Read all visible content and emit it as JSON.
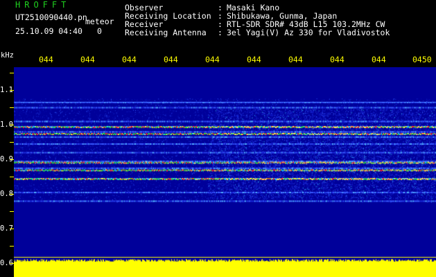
{
  "header": {
    "brand": "HROFFT",
    "filename": "UT2510090440.pn",
    "mode": "meteor",
    "datetime": "25.10.09 04:40",
    "counter": "0",
    "fields": [
      {
        "label": "Observer",
        "value": "Masaki Kano"
      },
      {
        "label": "Receiving Location",
        "value": "Shibukawa, Gunma, Japan"
      },
      {
        "label": "Receiver",
        "value": "RTL-SDR SDR# 43dB L15 103.2MHz CW"
      },
      {
        "label": "Receiving Antenna",
        "value": "3el Yagi(V) Az 330 for Vladivostok"
      }
    ],
    "separator": ":"
  },
  "time_ticks": [
    "044",
    "044",
    "044",
    "044",
    "044",
    "044",
    "044",
    "044",
    "044",
    "0450"
  ],
  "y_axis": {
    "unit": "kHz",
    "labels": [
      "1.1",
      "1.0",
      "0.9",
      "0.8",
      "0.7",
      "0.6"
    ]
  },
  "colors": {
    "background": "#000000",
    "plot_background": "#00009a",
    "ticks": "#ffff00",
    "brand": "#1fd21f",
    "text": "#ffffff",
    "power_trace": "#ffff00"
  },
  "spectrogram": {
    "frequency_range_khz": [
      0.6,
      1.15
    ],
    "carrier_lines_khz": [
      1.05,
      1.035,
      0.995,
      0.98,
      0.965,
      0.95,
      0.93,
      0.905,
      0.88,
      0.86,
      0.83,
      0.79,
      0.765
    ],
    "strong_lines_khz": [
      0.98,
      0.96,
      0.877,
      0.855,
      0.83
    ]
  }
}
